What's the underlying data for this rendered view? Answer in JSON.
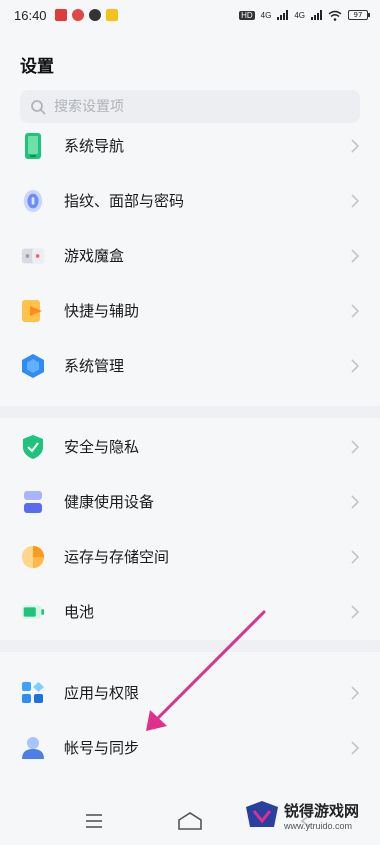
{
  "status_bar": {
    "time": "16:40",
    "network_labels": [
      "HD",
      "4G",
      "4G"
    ],
    "battery": "97"
  },
  "page": {
    "title": "设置",
    "search_placeholder": "搜索设置项"
  },
  "settings": [
    {
      "id": "nav",
      "label": "系统导航",
      "icon": "phone-nav-icon"
    },
    {
      "id": "fingerprint",
      "label": "指纹、面部与密码",
      "icon": "fingerprint-icon"
    },
    {
      "id": "game",
      "label": "游戏魔盒",
      "icon": "gamepad-icon"
    },
    {
      "id": "shortcut",
      "label": "快捷与辅助",
      "icon": "shortcut-icon"
    },
    {
      "id": "system",
      "label": "系统管理",
      "icon": "hexagon-icon"
    },
    {
      "id": "security",
      "label": "安全与隐私",
      "icon": "shield-icon"
    },
    {
      "id": "health",
      "label": "健康使用设备",
      "icon": "hourglass-icon"
    },
    {
      "id": "storage",
      "label": "运存与存储空间",
      "icon": "pie-icon"
    },
    {
      "id": "battery",
      "label": "电池",
      "icon": "battery-icon"
    },
    {
      "id": "apps",
      "label": "应用与权限",
      "icon": "apps-grid-icon"
    },
    {
      "id": "account",
      "label": "帐号与同步",
      "icon": "person-icon"
    }
  ],
  "colors": {
    "accent_green": "#1ec47a",
    "accent_blue": "#2f8bf5",
    "arrow": "#e0308c"
  },
  "watermark": {
    "main": "锐得游戏网",
    "url": "www.ytruido.com"
  }
}
